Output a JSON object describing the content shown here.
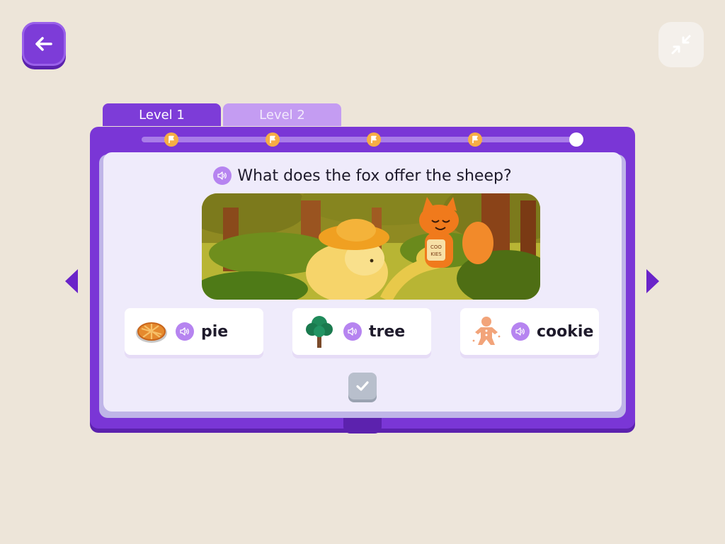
{
  "toolbar": {
    "back_icon": "arrow-left-icon",
    "collapse_icon": "collapse-arrows-icon"
  },
  "tabs": [
    {
      "label": "Level 1",
      "active": true
    },
    {
      "label": "Level 2",
      "active": false
    }
  ],
  "progress": {
    "checkpoints": 5,
    "reached_flags": 4,
    "flag_icon": "flag-icon"
  },
  "question": {
    "text": "What does the fox offer the sheep?",
    "audio_icon": "speaker-icon",
    "illustration": "fox-and-sheep-forest-illustration"
  },
  "answers": [
    {
      "label": "pie",
      "icon": "pie-icon"
    },
    {
      "label": "tree",
      "icon": "tree-icon"
    },
    {
      "label": "cookie",
      "icon": "gingerbread-cookie-icon"
    }
  ],
  "check_button": {
    "icon": "checkmark-icon",
    "enabled": false
  },
  "colors": {
    "background": "#ede5d9",
    "accent": "#7d3cd8",
    "tab_inactive": "#c49cf2",
    "flag": "#f6ad45",
    "page": "#efebfb"
  }
}
